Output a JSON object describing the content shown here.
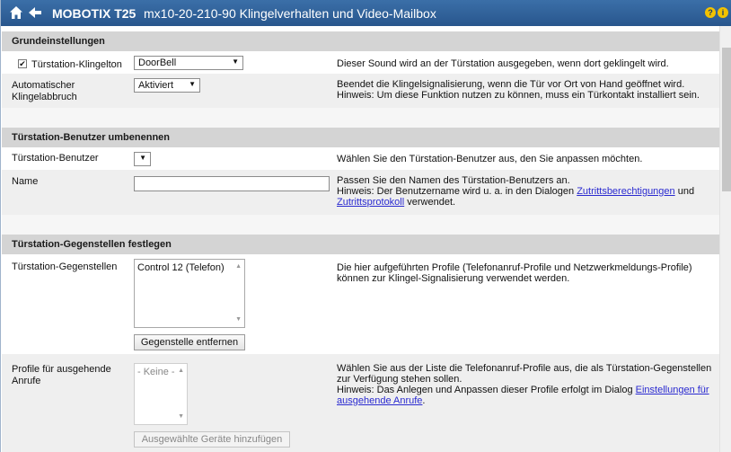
{
  "titlebar": {
    "brand": "MOBOTIX T25",
    "title": "mx10-20-210-90 Klingelverhalten und Video-Mailbox",
    "help": "?",
    "info": "i"
  },
  "sections": {
    "basic": {
      "title": "Grundeinstellungen"
    },
    "rename": {
      "title": "Türstation-Benutzer umbenennen"
    },
    "peers": {
      "title": "Türstation-Gegenstellen festlegen"
    }
  },
  "basic": {
    "ringtone": {
      "label": "Türstation-Klingelton",
      "value": "DoorBell",
      "checked": true,
      "desc": "Dieser Sound wird an der Türstation ausgegeben, wenn dort geklingelt wird."
    },
    "auto_stop": {
      "label": "Automatischer Klingelabbruch",
      "value": "Aktiviert",
      "desc1": "Beendet die Klingelsignalisierung, wenn die Tür vor Ort von Hand geöffnet wird.",
      "desc2": "Hinweis: Um diese Funktion nutzen zu können, muss ein Türkontakt installiert sein."
    }
  },
  "rename": {
    "user": {
      "label": "Türstation-Benutzer",
      "value": "",
      "desc": "Wählen Sie den Türstation-Benutzer aus, den Sie anpassen möchten."
    },
    "name": {
      "label": "Name",
      "value": "",
      "desc1": "Passen Sie den Namen des Türstation-Benutzers an.",
      "desc2": "Hinweis: Der Benutzername wird u. a. in den Dialogen",
      "link1": "Zutrittsberechtigungen",
      "desc3": "und",
      "link2": "Zutrittsprotokoll",
      "desc4": "verwendet."
    }
  },
  "peers": {
    "list": {
      "label": "Türstation-Gegenstellen",
      "items": [
        "Control 12   (Telefon)"
      ],
      "desc1": "Die hier aufgeführten Profile (Telefonanruf-Profile und Netzwerkmeldungs-Profile)",
      "desc2": "können zur Klingel-Signalisierung verwendet werden.",
      "remove_button": "Gegenstelle entfernen"
    },
    "outgoing": {
      "label": "Profile für ausgehende Anrufe",
      "items": [
        "- Keine -"
      ],
      "desc1": "Wählen Sie aus der Liste die Telefonanruf-Profile aus, die als Türstation-Gegenstellen",
      "desc2": "zur Verfügung stehen sollen.",
      "desc3": "Hinweis: Das Anlegen und Anpassen dieser Profile erfolgt im Dialog",
      "link": "Einstellungen für ausgehende Anrufe",
      "desc4": ".",
      "add_button": "Ausgewählte Geräte hinzufügen"
    }
  },
  "colors": {
    "titlebar": "#2f6299",
    "section_header": "#d4d4d4",
    "row_alt": "#efefef",
    "link": "#2a2ad0"
  }
}
